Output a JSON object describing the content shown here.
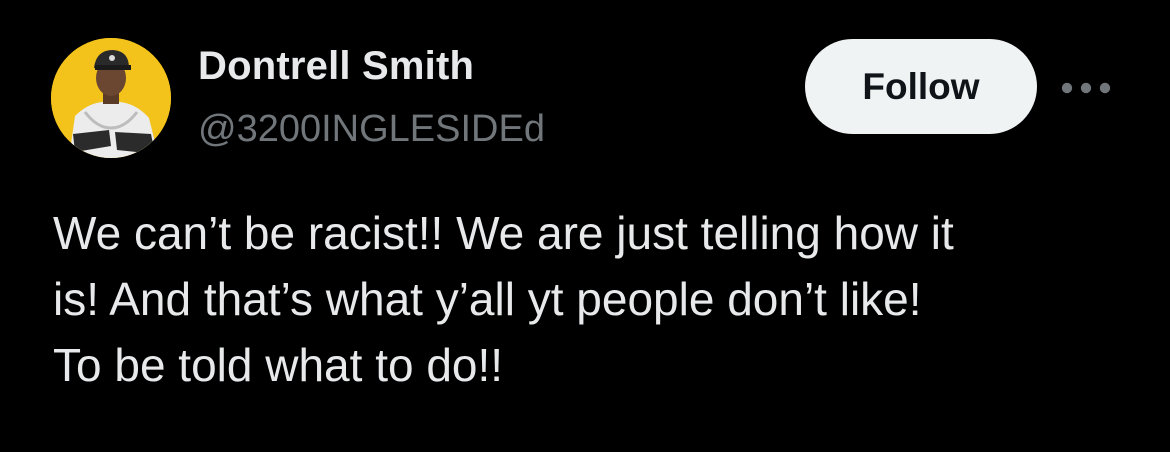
{
  "tweet": {
    "author": {
      "display_name": "Dontrell Smith",
      "handle": "@3200INGLESIDEd"
    },
    "follow_label": "Follow",
    "more_icon": "more-horizontal-icon",
    "text": "We can’t be racist!! We are just telling how it\nis! And that’s what y’all yt people don’t like!\nTo be told what to do!!"
  },
  "colors": {
    "background": "#000000",
    "primary_text": "#e7e9ea",
    "secondary_text": "#71767b",
    "follow_bg": "#eff3f4",
    "follow_text": "#0f1419",
    "avatar_bg": "#f3c21b"
  }
}
